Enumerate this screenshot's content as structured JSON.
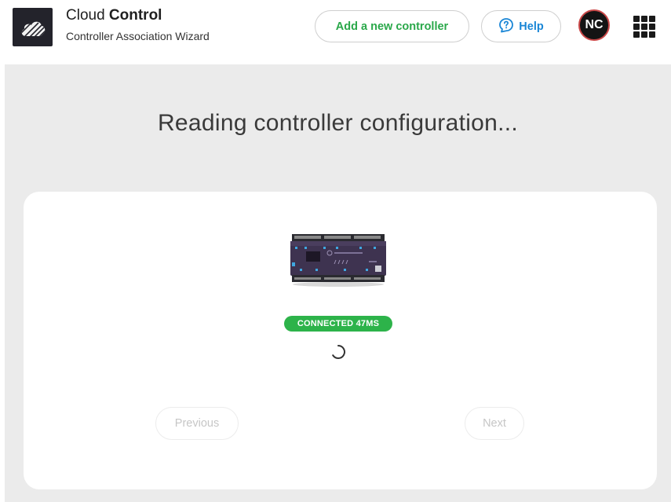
{
  "header": {
    "logo_icon": "cloud-icon",
    "title_light": "Cloud ",
    "title_bold": "Control",
    "subtitle": "Controller Association Wizard",
    "add_controller_label": "Add a new controller",
    "help_label": "Help",
    "help_icon": "help-bubble-icon",
    "avatar_initials": "NC",
    "apps_icon": "apps-grid-icon"
  },
  "main": {
    "heading": "Reading controller configuration...",
    "device_image": "controller-device-image",
    "status_badge": "CONNECTED 47MS",
    "spinner_icon": "loading-spinner-icon",
    "previous_label": "Previous",
    "next_label": "Next"
  },
  "colors": {
    "accent_green": "#2aa84a",
    "help_blue": "#1a86d6",
    "badge_green": "#2db34a",
    "background_gray": "#ebebeb"
  }
}
